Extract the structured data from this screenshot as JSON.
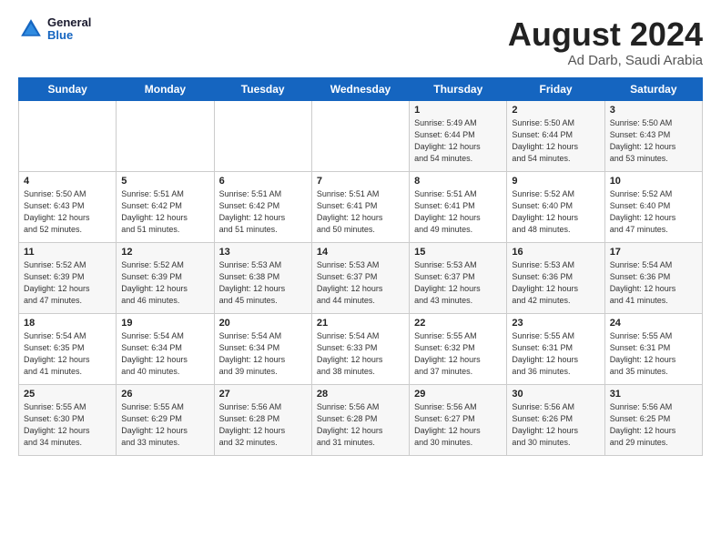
{
  "logo": {
    "line1": "General",
    "line2": "Blue"
  },
  "title": "August 2024",
  "subtitle": "Ad Darb, Saudi Arabia",
  "days_of_week": [
    "Sunday",
    "Monday",
    "Tuesday",
    "Wednesday",
    "Thursday",
    "Friday",
    "Saturday"
  ],
  "weeks": [
    [
      {
        "day": "",
        "info": ""
      },
      {
        "day": "",
        "info": ""
      },
      {
        "day": "",
        "info": ""
      },
      {
        "day": "",
        "info": ""
      },
      {
        "day": "1",
        "info": "Sunrise: 5:49 AM\nSunset: 6:44 PM\nDaylight: 12 hours\nand 54 minutes."
      },
      {
        "day": "2",
        "info": "Sunrise: 5:50 AM\nSunset: 6:44 PM\nDaylight: 12 hours\nand 54 minutes."
      },
      {
        "day": "3",
        "info": "Sunrise: 5:50 AM\nSunset: 6:43 PM\nDaylight: 12 hours\nand 53 minutes."
      }
    ],
    [
      {
        "day": "4",
        "info": "Sunrise: 5:50 AM\nSunset: 6:43 PM\nDaylight: 12 hours\nand 52 minutes."
      },
      {
        "day": "5",
        "info": "Sunrise: 5:51 AM\nSunset: 6:42 PM\nDaylight: 12 hours\nand 51 minutes."
      },
      {
        "day": "6",
        "info": "Sunrise: 5:51 AM\nSunset: 6:42 PM\nDaylight: 12 hours\nand 51 minutes."
      },
      {
        "day": "7",
        "info": "Sunrise: 5:51 AM\nSunset: 6:41 PM\nDaylight: 12 hours\nand 50 minutes."
      },
      {
        "day": "8",
        "info": "Sunrise: 5:51 AM\nSunset: 6:41 PM\nDaylight: 12 hours\nand 49 minutes."
      },
      {
        "day": "9",
        "info": "Sunrise: 5:52 AM\nSunset: 6:40 PM\nDaylight: 12 hours\nand 48 minutes."
      },
      {
        "day": "10",
        "info": "Sunrise: 5:52 AM\nSunset: 6:40 PM\nDaylight: 12 hours\nand 47 minutes."
      }
    ],
    [
      {
        "day": "11",
        "info": "Sunrise: 5:52 AM\nSunset: 6:39 PM\nDaylight: 12 hours\nand 47 minutes."
      },
      {
        "day": "12",
        "info": "Sunrise: 5:52 AM\nSunset: 6:39 PM\nDaylight: 12 hours\nand 46 minutes."
      },
      {
        "day": "13",
        "info": "Sunrise: 5:53 AM\nSunset: 6:38 PM\nDaylight: 12 hours\nand 45 minutes."
      },
      {
        "day": "14",
        "info": "Sunrise: 5:53 AM\nSunset: 6:37 PM\nDaylight: 12 hours\nand 44 minutes."
      },
      {
        "day": "15",
        "info": "Sunrise: 5:53 AM\nSunset: 6:37 PM\nDaylight: 12 hours\nand 43 minutes."
      },
      {
        "day": "16",
        "info": "Sunrise: 5:53 AM\nSunset: 6:36 PM\nDaylight: 12 hours\nand 42 minutes."
      },
      {
        "day": "17",
        "info": "Sunrise: 5:54 AM\nSunset: 6:36 PM\nDaylight: 12 hours\nand 41 minutes."
      }
    ],
    [
      {
        "day": "18",
        "info": "Sunrise: 5:54 AM\nSunset: 6:35 PM\nDaylight: 12 hours\nand 41 minutes."
      },
      {
        "day": "19",
        "info": "Sunrise: 5:54 AM\nSunset: 6:34 PM\nDaylight: 12 hours\nand 40 minutes."
      },
      {
        "day": "20",
        "info": "Sunrise: 5:54 AM\nSunset: 6:34 PM\nDaylight: 12 hours\nand 39 minutes."
      },
      {
        "day": "21",
        "info": "Sunrise: 5:54 AM\nSunset: 6:33 PM\nDaylight: 12 hours\nand 38 minutes."
      },
      {
        "day": "22",
        "info": "Sunrise: 5:55 AM\nSunset: 6:32 PM\nDaylight: 12 hours\nand 37 minutes."
      },
      {
        "day": "23",
        "info": "Sunrise: 5:55 AM\nSunset: 6:31 PM\nDaylight: 12 hours\nand 36 minutes."
      },
      {
        "day": "24",
        "info": "Sunrise: 5:55 AM\nSunset: 6:31 PM\nDaylight: 12 hours\nand 35 minutes."
      }
    ],
    [
      {
        "day": "25",
        "info": "Sunrise: 5:55 AM\nSunset: 6:30 PM\nDaylight: 12 hours\nand 34 minutes."
      },
      {
        "day": "26",
        "info": "Sunrise: 5:55 AM\nSunset: 6:29 PM\nDaylight: 12 hours\nand 33 minutes."
      },
      {
        "day": "27",
        "info": "Sunrise: 5:56 AM\nSunset: 6:28 PM\nDaylight: 12 hours\nand 32 minutes."
      },
      {
        "day": "28",
        "info": "Sunrise: 5:56 AM\nSunset: 6:28 PM\nDaylight: 12 hours\nand 31 minutes."
      },
      {
        "day": "29",
        "info": "Sunrise: 5:56 AM\nSunset: 6:27 PM\nDaylight: 12 hours\nand 30 minutes."
      },
      {
        "day": "30",
        "info": "Sunrise: 5:56 AM\nSunset: 6:26 PM\nDaylight: 12 hours\nand 30 minutes."
      },
      {
        "day": "31",
        "info": "Sunrise: 5:56 AM\nSunset: 6:25 PM\nDaylight: 12 hours\nand 29 minutes."
      }
    ]
  ]
}
